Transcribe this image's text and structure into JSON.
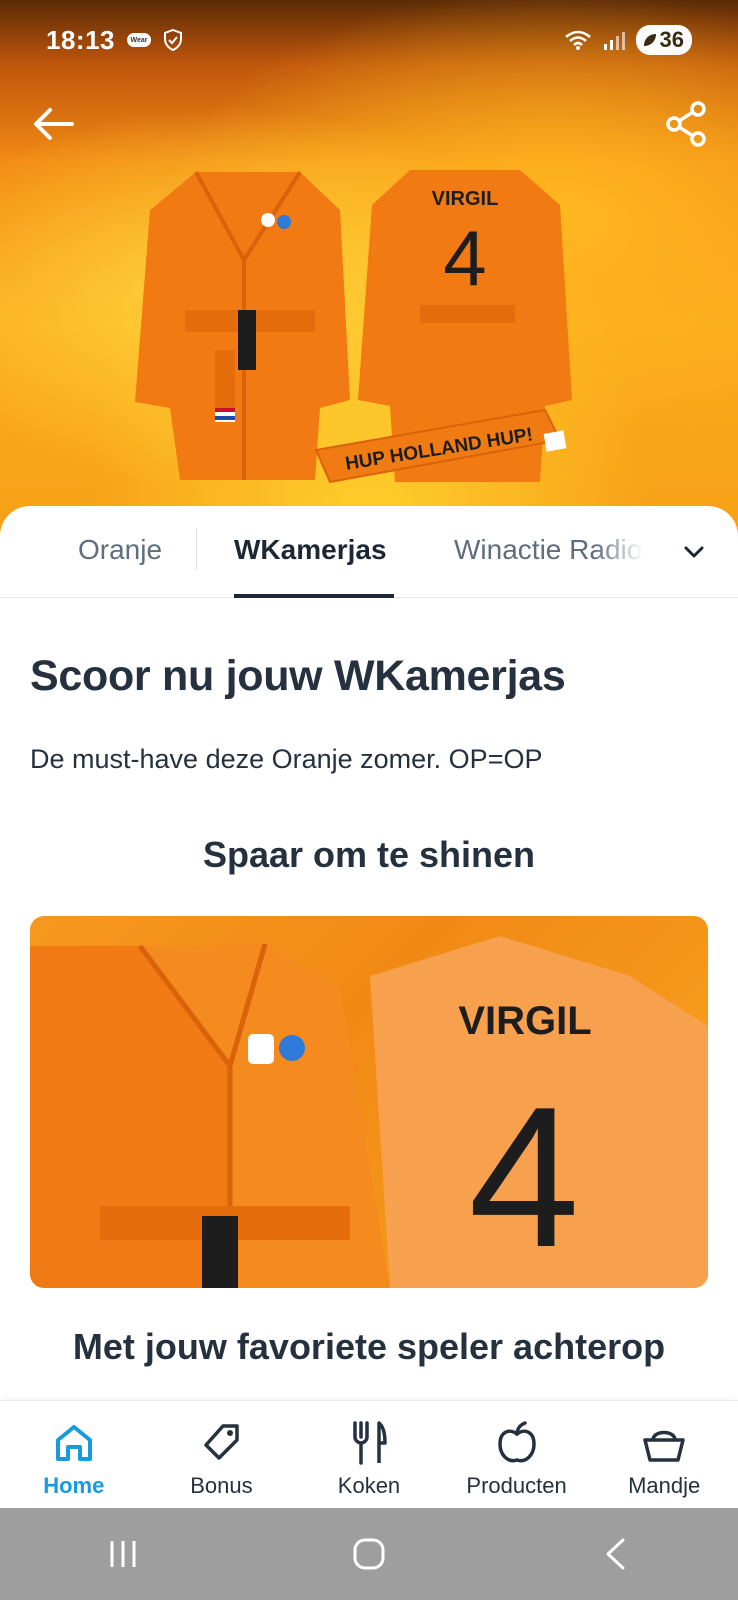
{
  "status_bar": {
    "time": "18:13",
    "wear_badge": "Wear",
    "network": "5",
    "battery": "36"
  },
  "hero": {
    "back_icon": "arrow-left-icon",
    "share_icon": "share-icon",
    "robe_back_name": "VIRGIL",
    "robe_back_number": "4",
    "scarf_text": "HUP HOLLAND HUP!"
  },
  "tabs": {
    "items": [
      {
        "label": "Oranje",
        "active": false
      },
      {
        "label": "WKamerjas",
        "active": true
      },
      {
        "label": "Winactie Radio",
        "active": false
      }
    ],
    "more_icon": "chevron-down-icon"
  },
  "content": {
    "title": "Scoor nu jouw WKamerjas",
    "intro": "De must-have deze Oranje zomer. OP=OP",
    "section1_title": "Spaar om te shinen",
    "promo_back_name": "VIRGIL",
    "promo_back_number": "4",
    "section2_title": "Met jouw favoriete speler achterop"
  },
  "bottom_nav": {
    "items": [
      {
        "label": "Home",
        "icon": "home-icon",
        "active": true
      },
      {
        "label": "Bonus",
        "icon": "tag-icon",
        "active": false
      },
      {
        "label": "Koken",
        "icon": "cutlery-icon",
        "active": false
      },
      {
        "label": "Producten",
        "icon": "apple-icon",
        "active": false
      },
      {
        "label": "Mandje",
        "icon": "basket-icon",
        "active": false
      }
    ]
  },
  "colors": {
    "accent": "#179be0",
    "text": "#25313e",
    "orange": "#f07b12"
  }
}
